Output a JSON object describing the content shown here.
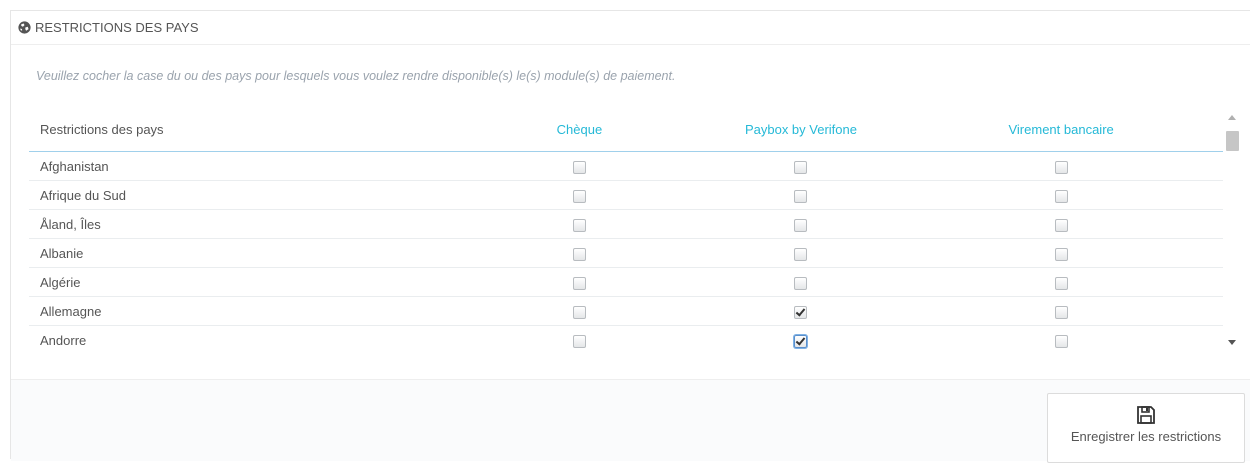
{
  "panel": {
    "title": "RESTRICTIONS DES PAYS",
    "icon": "globe-icon",
    "help_text": "Veuillez cocher la case du ou des pays pour lesquels vous voulez rendre disponible(s) le(s) module(s) de paiement."
  },
  "table": {
    "headers": [
      "Restrictions des pays",
      "Chèque",
      "Paybox by Verifone",
      "Virement bancaire"
    ],
    "rows": [
      {
        "country": "Afghanistan",
        "cheque": false,
        "paybox": false,
        "virement": false
      },
      {
        "country": "Afrique du Sud",
        "cheque": false,
        "paybox": false,
        "virement": false
      },
      {
        "country": "Åland, Îles",
        "cheque": false,
        "paybox": false,
        "virement": false
      },
      {
        "country": "Albanie",
        "cheque": false,
        "paybox": false,
        "virement": false
      },
      {
        "country": "Algérie",
        "cheque": false,
        "paybox": false,
        "virement": false
      },
      {
        "country": "Allemagne",
        "cheque": false,
        "paybox": true,
        "virement": false
      },
      {
        "country": "Andorre",
        "cheque": false,
        "paybox": true,
        "virement": false
      }
    ]
  },
  "footer": {
    "save_label": "Enregistrer les restrictions",
    "save_icon": "floppy-disk-icon"
  },
  "colors": {
    "accent": "#25b9d7",
    "text": "#555555",
    "help": "#9aa3ad"
  }
}
